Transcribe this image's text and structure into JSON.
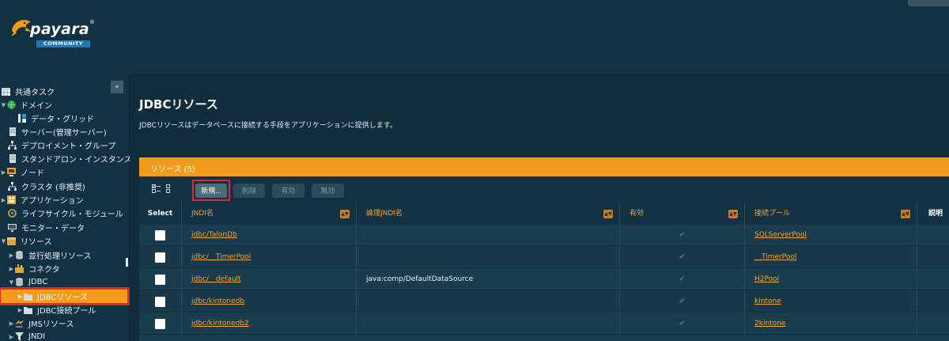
{
  "brand": {
    "name": "payara",
    "reg": "®",
    "edition": "COMMUNITY"
  },
  "sidebar": {
    "collapse_label": "«",
    "items": [
      {
        "label": "共通タスク",
        "icon": "calendar-icon",
        "expander": ""
      },
      {
        "label": "ドメイン",
        "icon": "globe-icon",
        "expander": "▼"
      },
      {
        "label": "データ・グリッド",
        "icon": "data-grid-icon",
        "expander": ""
      },
      {
        "label": "サーバー(管理サーバー)",
        "icon": "server-icon",
        "expander": ""
      },
      {
        "label": "デプロイメント・グループ",
        "icon": "deployment-group-icon",
        "expander": ""
      },
      {
        "label": "スタンドアロン・インスタンス",
        "icon": "server-icon",
        "expander": ""
      },
      {
        "label": "ノード",
        "icon": "node-icon",
        "expander": "▶"
      },
      {
        "label": "クラスタ (非推奨)",
        "icon": "cluster-icon",
        "expander": ""
      },
      {
        "label": "アプリケーション",
        "icon": "applications-icon",
        "expander": "▶"
      },
      {
        "label": "ライフサイクル・モジュール",
        "icon": "lifecycle-icon",
        "expander": ""
      },
      {
        "label": "モニター・データ",
        "icon": "monitor-icon",
        "expander": ""
      },
      {
        "label": "リソース",
        "icon": "resources-icon",
        "expander": "▼"
      },
      {
        "label": "並行処理リソース",
        "icon": "database-icon",
        "expander": "▶"
      },
      {
        "label": "コネクタ",
        "icon": "connector-icon",
        "expander": "▶"
      },
      {
        "label": "JDBC",
        "icon": "database-icon",
        "expander": "▼"
      },
      {
        "label": "JDBCリソース",
        "icon": "folder-icon",
        "expander": "▶"
      },
      {
        "label": "JDBC接続プール",
        "icon": "folder-icon",
        "expander": "▶"
      },
      {
        "label": "JMSリソース",
        "icon": "jms-icon",
        "expander": "▶"
      },
      {
        "label": "JNDI",
        "icon": "jndi-icon",
        "expander": "▶"
      }
    ]
  },
  "main": {
    "title": "JDBCリソース",
    "description": "JDBCリソースはデータベースに接続する手段をアプリケーションに提供します。"
  },
  "table": {
    "title": "リソース (5)",
    "toolbar": {
      "new": "新規...",
      "delete": "削除",
      "enable": "有効",
      "disable": "無効"
    },
    "columns": [
      "Select",
      "JNDI名",
      "論理JNDI名",
      "有効",
      "接続プール",
      "説明"
    ],
    "rows": [
      {
        "jndi": "jdbc/TalonDb",
        "logical": "",
        "enabled": "✓",
        "pool": "SQLServerPool"
      },
      {
        "jndi": "jdbc/__TimerPool",
        "logical": "",
        "enabled": "✓",
        "pool": "__TimerPool"
      },
      {
        "jndi": "jdbc/__default",
        "logical": "java:comp/DefaultDataSource",
        "enabled": "✓",
        "pool": "H2Pool"
      },
      {
        "jndi": "jdbc/kintonedb",
        "logical": "",
        "enabled": "✓",
        "pool": "kintone"
      },
      {
        "jndi": "jdbc/kintonedb2",
        "logical": "",
        "enabled": "✓",
        "pool": "2kintone"
      }
    ]
  },
  "colors": {
    "accent": "#f39c1c",
    "highlight": "#e8252c",
    "background": "#0f2d3c",
    "link": "#f3a23a"
  }
}
